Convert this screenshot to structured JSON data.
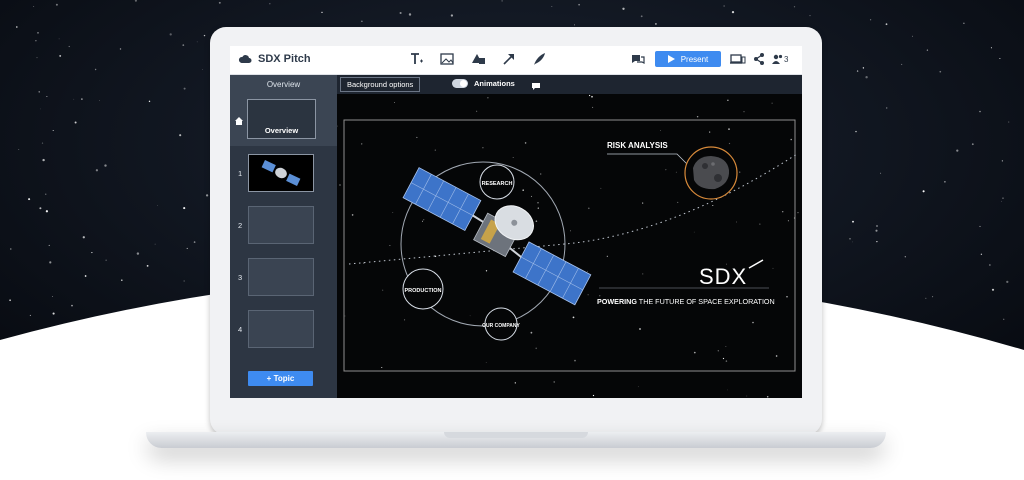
{
  "app": {
    "title": "SDX Pitch"
  },
  "toolbar": {
    "tools": [
      {
        "name": "text-tool-icon"
      },
      {
        "name": "image-tool-icon"
      },
      {
        "name": "shapes-tool-icon"
      },
      {
        "name": "arrow-tool-icon"
      },
      {
        "name": "draw-tool-icon"
      }
    ],
    "present_label": "Present",
    "share_count": "3"
  },
  "subbar": {
    "background_options_label": "Background options",
    "animations_label": "Animations",
    "animations_on": true
  },
  "sidebar": {
    "header": "Overview",
    "overview_label": "Overview",
    "slides": [
      {
        "number": "1",
        "active": true
      },
      {
        "number": "2",
        "active": false
      },
      {
        "number": "3",
        "active": false
      },
      {
        "number": "4",
        "active": false
      }
    ],
    "add_topic_label": "+ Topic"
  },
  "slide": {
    "topics": [
      "RESEARCH",
      "PRODUCTION",
      "OUR COMPANY"
    ],
    "risk_label": "RISK ANALYSIS",
    "logo_text": "SDX",
    "tagline_bold": "POWERING",
    "tagline_rest": " THE FUTURE OF SPACE EXPLORATION"
  },
  "colors": {
    "accent": "#3e8bf0",
    "sidebar_bg": "#2d3643",
    "orbit": "#c9d2de",
    "risk_ring": "#d88a3a"
  }
}
